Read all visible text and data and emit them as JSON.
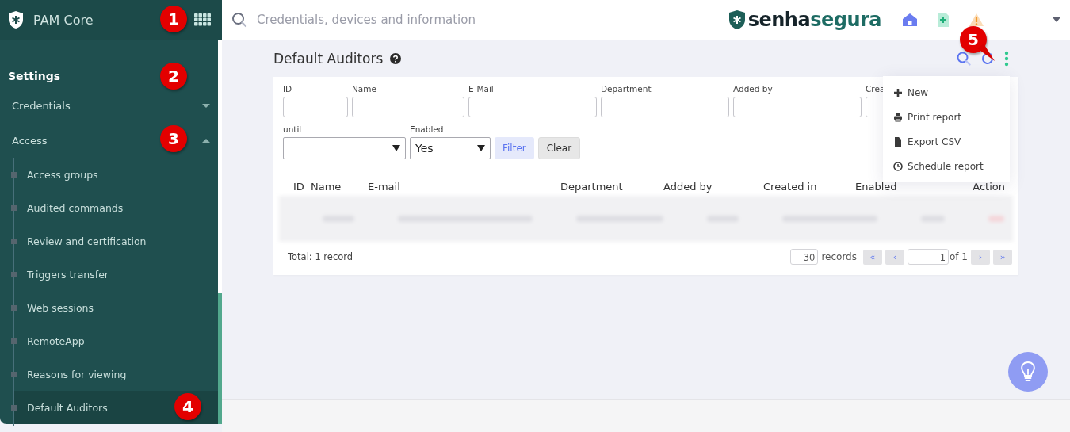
{
  "sidebar": {
    "app_name": "PAM Core",
    "section_title": "Settings",
    "items": [
      {
        "label": "Credentials",
        "expanded": false
      },
      {
        "label": "Access",
        "expanded": true,
        "children": [
          {
            "label": "Access groups",
            "selected": false
          },
          {
            "label": "Audited commands",
            "selected": false
          },
          {
            "label": "Review and certification",
            "selected": false
          },
          {
            "label": "Triggers transfer",
            "selected": false
          },
          {
            "label": "Web sessions",
            "selected": false
          },
          {
            "label": "RemoteApp",
            "selected": false
          },
          {
            "label": "Reasons for viewing",
            "selected": false
          },
          {
            "label": "Default Auditors",
            "selected": true
          }
        ]
      }
    ]
  },
  "topbar": {
    "search": {
      "placeholder": "Credentials, devices and information"
    },
    "logo": {
      "dark_part": "senha",
      "teal_part": "segura"
    }
  },
  "page": {
    "title": "Default Auditors",
    "filters": [
      {
        "label": "ID",
        "kind": "input"
      },
      {
        "label": "Name",
        "kind": "input"
      },
      {
        "label": "E-Mail",
        "kind": "input"
      },
      {
        "label": "Department",
        "kind": "input"
      },
      {
        "label": "Added by",
        "kind": "input"
      },
      {
        "label": "Crea",
        "kind": "input"
      },
      {
        "label": "until",
        "kind": "select"
      },
      {
        "label": "Enabled",
        "kind": "select",
        "value": "Yes"
      }
    ],
    "filter_buttons": [
      {
        "label": "Filter",
        "kind": "primary"
      },
      {
        "label": "Clear",
        "kind": "secondary"
      }
    ],
    "table": {
      "columns": [
        "ID",
        "Name",
        "E-mail",
        "Department",
        "Added by",
        "Created in",
        "Enabled",
        "Action"
      ],
      "rows": [
        {
          "kind": "blurred"
        }
      ]
    },
    "footer": {
      "total": "Total: 1 record",
      "per_page": "30",
      "records_label": "records",
      "first": "«",
      "prev": "‹",
      "page": "1",
      "of": "of 1",
      "next": "›",
      "last": "»"
    },
    "menu": [
      {
        "label": "New"
      },
      {
        "label": "Print report"
      },
      {
        "label": "Export CSV"
      },
      {
        "label": "Schedule report"
      }
    ]
  },
  "callouts": [
    {
      "text": "1"
    },
    {
      "text": "2"
    },
    {
      "text": "3"
    },
    {
      "text": "4"
    },
    {
      "text": "5"
    }
  ]
}
